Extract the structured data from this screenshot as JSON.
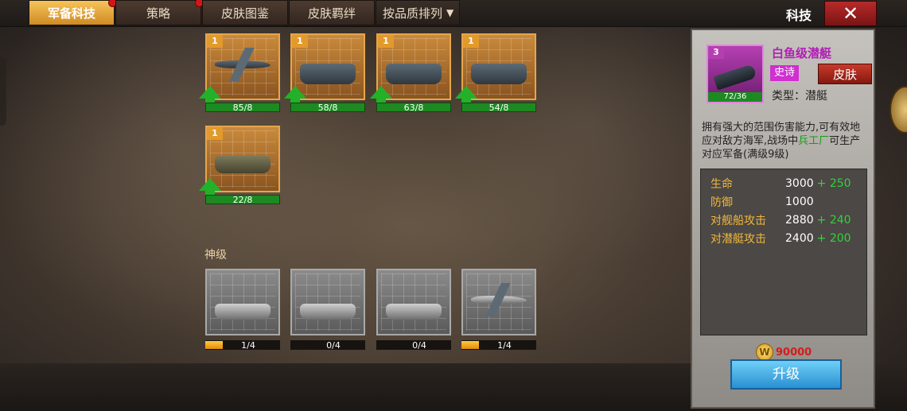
{
  "tabs": [
    {
      "label": "军备科技",
      "active": true,
      "dot": true
    },
    {
      "label": "策略",
      "active": false,
      "dot": true
    },
    {
      "label": "皮肤图鉴",
      "active": false,
      "dot": false
    },
    {
      "label": "皮肤羁绊",
      "active": false,
      "dot": false
    }
  ],
  "sort": {
    "label": "按品质排列"
  },
  "header": {
    "title": "科技",
    "close_icon": "close-icon"
  },
  "cards_top": [
    {
      "level": "1",
      "progress": "85/8",
      "icon": "bomber-plane"
    },
    {
      "level": "1",
      "progress": "58/8",
      "icon": "battleship"
    },
    {
      "level": "1",
      "progress": "63/8",
      "icon": "cruiser"
    },
    {
      "level": "1",
      "progress": "54/8",
      "icon": "aircraft-carrier"
    },
    {
      "level": "1",
      "progress": "22/8",
      "icon": "anti-air-tank"
    }
  ],
  "section": {
    "label": "神级"
  },
  "cards_god": [
    {
      "progress": "1/4",
      "icon": "heavy-tank",
      "fill": 0.25
    },
    {
      "progress": "0/4",
      "icon": "tank-destroyer",
      "fill": 0
    },
    {
      "progress": "0/4",
      "icon": "artillery",
      "fill": 0
    },
    {
      "progress": "1/4",
      "icon": "jet-plane",
      "fill": 0.25
    }
  ],
  "detail": {
    "level": "3",
    "progress": "72/36",
    "name": "白鱼级潜艇",
    "rarity": "史诗",
    "skin_label": "皮肤",
    "type": "类型：潜艇",
    "desc_1": "拥有强大的范围伤害能力,可有效地应对敌方海军,战场中",
    "desc_hl": "兵工厂",
    "desc_2": "可生产对应军备(满级9级)",
    "stats": [
      {
        "name": "生命",
        "value": "3000",
        "bonus": "+ 250"
      },
      {
        "name": "防御",
        "value": "1000",
        "bonus": ""
      },
      {
        "name": "对舰船攻击",
        "value": "2880",
        "bonus": "+ 240"
      },
      {
        "name": "对潜艇攻击",
        "value": "2400",
        "bonus": "+ 200"
      }
    ],
    "cost": "90000",
    "upgrade_label": "升级"
  },
  "colors": {
    "accent": "#e39a2c",
    "green": "#23b12a",
    "epic": "#d12fd1",
    "danger": "#d21d1d"
  }
}
